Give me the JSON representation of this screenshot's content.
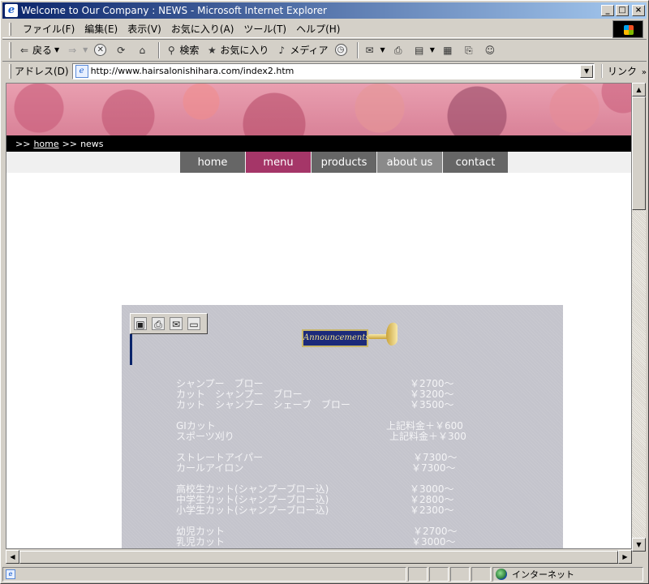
{
  "window": {
    "title": "Welcome to Our Company : NEWS - Microsoft Internet Explorer",
    "min": "_",
    "max": "□",
    "close": "×"
  },
  "menubar": [
    "ファイル(F)",
    "編集(E)",
    "表示(V)",
    "お気に入り(A)",
    "ツール(T)",
    "ヘルプ(H)"
  ],
  "toolbar": {
    "back": "戻る",
    "search": "検索",
    "favorites": "お気に入り",
    "media": "メディア"
  },
  "address": {
    "label": "アドレス(D)",
    "url": "http://www.hairsalonishihara.com/index2.htm",
    "links": "リンク",
    "links_chevron": "»"
  },
  "breadcrumb": {
    "sep": ">>",
    "home": "home",
    "current": "news"
  },
  "nav": [
    {
      "label": "home",
      "color": "#666666"
    },
    {
      "label": "menu",
      "color": "#a53668"
    },
    {
      "label": "products",
      "color": "#666666"
    },
    {
      "label": "about us",
      "color": "#8a8a8a"
    },
    {
      "label": "contact",
      "color": "#666666"
    }
  ],
  "announcement": "Announcements",
  "menu": [
    {
      "name": "シャンプー　ブロー",
      "price": "￥2700～"
    },
    {
      "name": "カット　シャンプー　ブロー",
      "price": "￥3200～"
    },
    {
      "name": "カット　シャンプー　シェーブ　ブロー",
      "price": "￥3500～"
    },
    {
      "name": "GIカット",
      "price": "上記料金＋￥600"
    },
    {
      "name": "スポーツ刈り",
      "price": "上記料金＋￥300"
    },
    {
      "name": "ストレートアイパー",
      "price": "￥7300～"
    },
    {
      "name": "カールアイロン",
      "price": "￥7300～"
    },
    {
      "name": "高校生カット(シャンプーブロー込)",
      "price": "￥3000～"
    },
    {
      "name": "中学生カット(シャンプーブロー込)",
      "price": "￥2800～"
    },
    {
      "name": "小学生カット(シャンプーブロー込)",
      "price": "￥2300～"
    },
    {
      "name": "幼児カット",
      "price": "￥2700～"
    },
    {
      "name": "乳児カット",
      "price": "￥3000～"
    }
  ],
  "status": {
    "zone": "インターネット"
  }
}
